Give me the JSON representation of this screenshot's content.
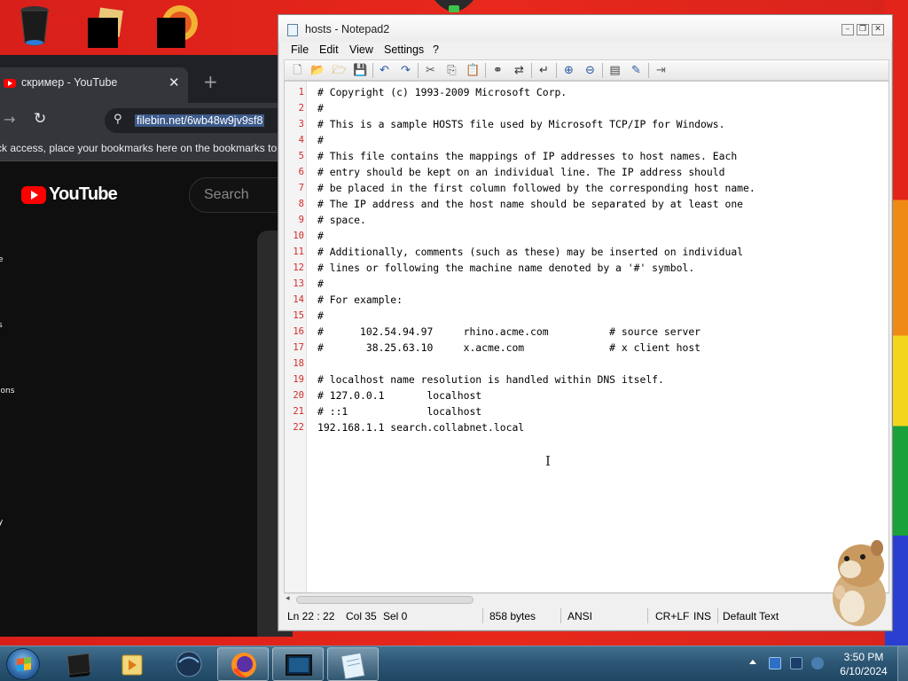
{
  "notepad": {
    "title": "hosts - Notepad2",
    "menu": [
      "File",
      "Edit",
      "View",
      "Settings",
      "?"
    ],
    "lines": [
      {
        "n": "1",
        "text": "# Copyright (c) 1993-2009 Microsoft Corp."
      },
      {
        "n": "2",
        "text": "#"
      },
      {
        "n": "3",
        "text": "# This is a sample HOSTS file used by Microsoft TCP/IP for Windows."
      },
      {
        "n": "4",
        "text": "#"
      },
      {
        "n": "5",
        "text": "# This file contains the mappings of IP addresses to host names. Each"
      },
      {
        "n": "6",
        "text": "# entry should be kept on an individual line. The IP address should"
      },
      {
        "n": "7",
        "text": "# be placed in the first column followed by the corresponding host name."
      },
      {
        "n": "8",
        "text": "# The IP address and the host name should be separated by at least one"
      },
      {
        "n": "9",
        "text": "# space."
      },
      {
        "n": "10",
        "text": "#"
      },
      {
        "n": "11",
        "text": "# Additionally, comments (such as these) may be inserted on individual"
      },
      {
        "n": "12",
        "text": "# lines or following the machine name denoted by a '#' symbol."
      },
      {
        "n": "13",
        "text": "#"
      },
      {
        "n": "14",
        "text": "# For example:"
      },
      {
        "n": "15",
        "text": "#"
      },
      {
        "n": "16",
        "text": "#      102.54.94.97     rhino.acme.com          # source server"
      },
      {
        "n": "17",
        "text": "#       38.25.63.10     x.acme.com              # x client host"
      },
      {
        "n": "18",
        "text": ""
      },
      {
        "n": "19",
        "text": "# localhost name resolution is handled within DNS itself."
      },
      {
        "n": "20",
        "text": "# 127.0.0.1       localhost"
      },
      {
        "n": "21",
        "text": "# ::1             localhost"
      },
      {
        "n": "22",
        "text": "192.168.1.1 search.collabnet.local"
      }
    ],
    "status": {
      "position": "Ln 22 : 22",
      "col": "Col 35",
      "sel": "Sel 0",
      "size": "858 bytes",
      "encoding": "ANSI",
      "eol": "CR+LF",
      "mode": "INS",
      "scheme": "Default Text"
    }
  },
  "browser": {
    "tab_title": "скример - YouTube",
    "url": "filebin.net/6wb48w9jv9sf8",
    "bookmarks_hint": "ck access, place your bookmarks here on the bookmarks to",
    "logo_text": "YouTube",
    "search_placeholder": "Search",
    "side_labels": [
      "e",
      "s",
      "ions",
      "y"
    ]
  },
  "taskbar": {
    "time": "3:50 PM",
    "date": "6/10/2024"
  },
  "colors": {
    "desktop_red": "#e8281c",
    "line_number": "#d22b2b",
    "youtube_red": "#ff0000"
  }
}
